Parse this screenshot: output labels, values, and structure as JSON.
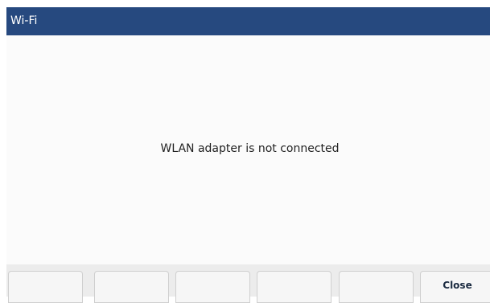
{
  "window": {
    "title": "Wi-Fi"
  },
  "main": {
    "message": "WLAN adapter is not connected"
  },
  "softkeys": [
    {
      "label": ""
    },
    {
      "label": ""
    },
    {
      "label": ""
    },
    {
      "label": ""
    },
    {
      "label": ""
    },
    {
      "label": "Close"
    }
  ],
  "colors": {
    "title_bar": "#26497f",
    "title_text": "#ffffff",
    "background": "#fbfbfb",
    "softkey_bar": "#ececec"
  }
}
